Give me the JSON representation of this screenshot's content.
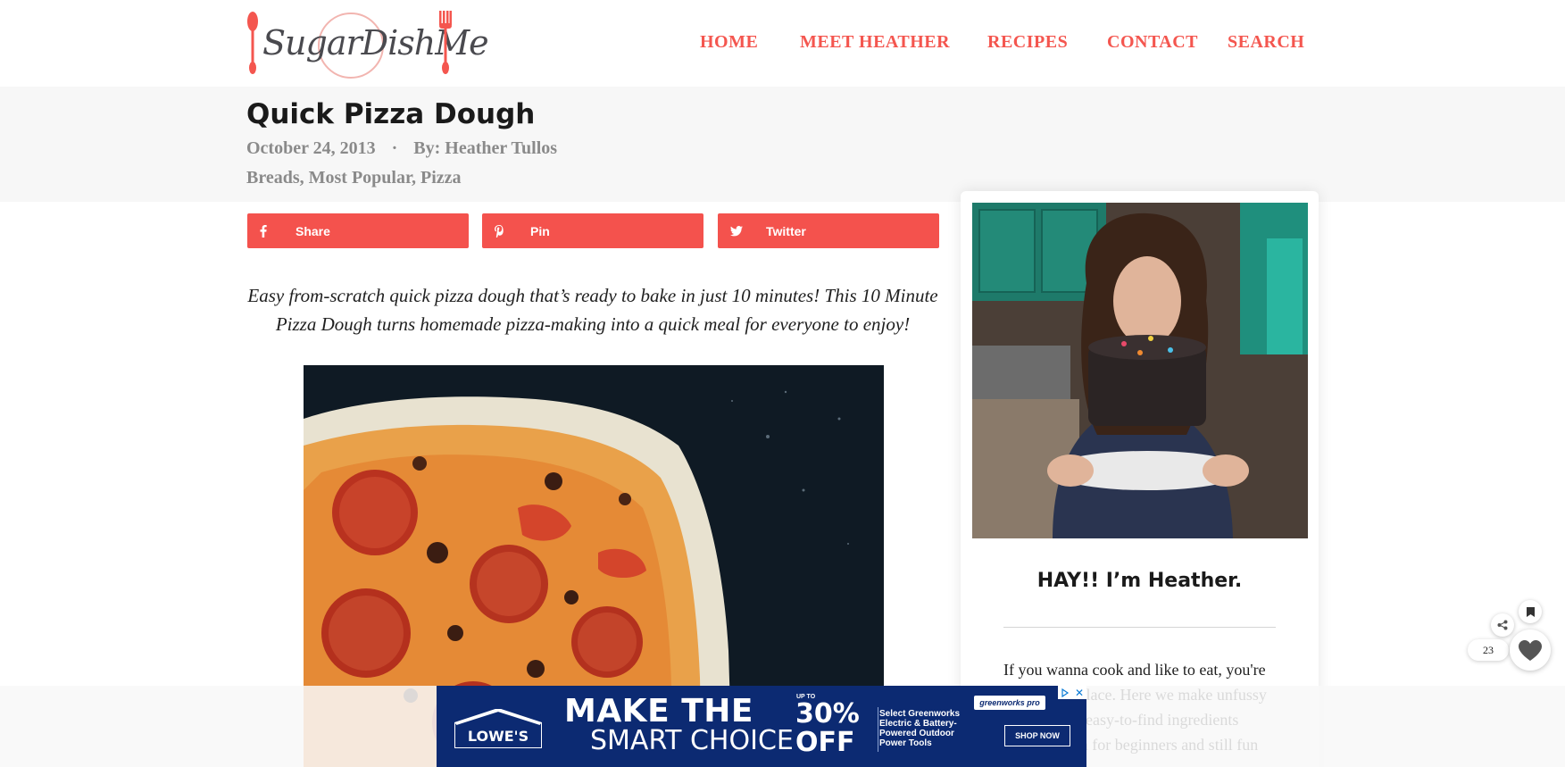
{
  "header": {
    "logo_text": "SugarDishMe",
    "nav": [
      {
        "label": "HOME"
      },
      {
        "label": "MEET HEATHER"
      },
      {
        "label": "RECIPES"
      },
      {
        "label": "CONTACT"
      },
      {
        "label": "SEARCH"
      }
    ]
  },
  "post": {
    "title": "Quick Pizza Dough",
    "date": "October 24, 2013",
    "separator": "·",
    "author": "By: Heather Tullos",
    "categories": "Breads, Most Popular, Pizza",
    "intro": "Easy from-scratch quick pizza dough that’s ready to bake in just 10 minutes! This 10 Minute Pizza Dough turns homemade pizza-making into a quick meal for everyone to enjoy!"
  },
  "share": {
    "facebook_label": "Share",
    "pinterest_label": "Pin",
    "twitter_label": "Twitter"
  },
  "sidebar": {
    "heading": "HAY!! I’m Heather.",
    "text": "If you wanna cook and like to eat, you're in the right place. Here we make unfussy recipes with easy-to-find ingredients that's enough for beginners and still fun"
  },
  "widgets": {
    "favorite_count": "23"
  },
  "ad": {
    "brand_logo": "LOWE'S",
    "headline_1": "MAKE THE",
    "headline_2": "SMART CHOICE",
    "up_to": "UP TO",
    "percent": "30%",
    "off": "OFF",
    "description": "Select Greenworks Electric & Battery-Powered Outdoor Power Tools",
    "partner": "greenworks pro",
    "cta": "SHOP NOW"
  },
  "colors": {
    "accent": "#f4564f",
    "ad_blue": "#0c2a72",
    "title_band": "#f7f7f7"
  },
  "icons": [
    "spoon-icon",
    "fork-icon",
    "facebook-icon",
    "pinterest-icon",
    "twitter-icon",
    "share-icon",
    "bookmark-icon",
    "heart-icon",
    "ad-info-icon",
    "ad-close-icon"
  ]
}
